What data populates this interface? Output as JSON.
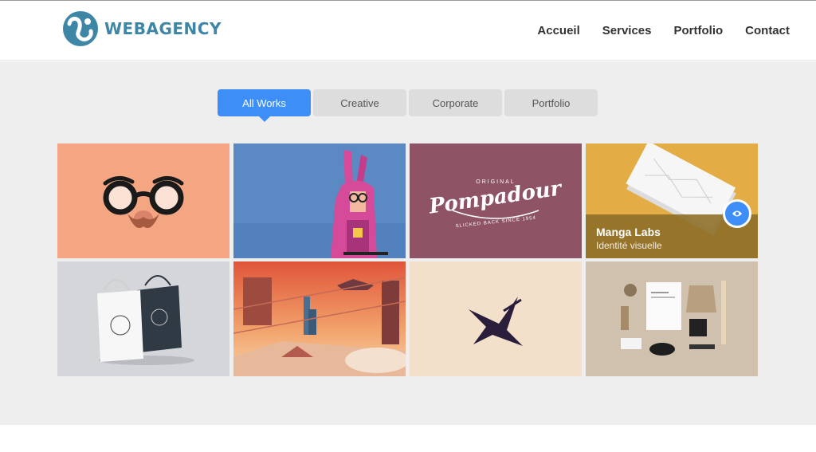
{
  "brand": {
    "name": "WEBAGENCY",
    "logo_icon": "swirl-logo-icon",
    "color": "#3d86a6"
  },
  "nav": {
    "items": [
      {
        "label": "Accueil"
      },
      {
        "label": "Services"
      },
      {
        "label": "Portfolio"
      },
      {
        "label": "Contact"
      }
    ]
  },
  "filters": {
    "items": [
      {
        "label": "All Works",
        "active": true
      },
      {
        "label": "Creative",
        "active": false
      },
      {
        "label": "Corporate",
        "active": false
      },
      {
        "label": "Portfolio",
        "active": false
      }
    ],
    "active_color": "#3e8ef7"
  },
  "portfolio": {
    "items": [
      {
        "image": "glasses-mustache-illustration"
      },
      {
        "image": "pink-bunny-costume-illustration"
      },
      {
        "image": "pompadour-logo-design",
        "logo_text": "Pompadour",
        "logo_top": "ORIGINAL",
        "logo_bottom": "SLICKED BACK SINCE 1954"
      },
      {
        "image": "business-card-mockup",
        "title": "Manga Labs",
        "subtitle": "Identité visuelle",
        "action_icon": "eye-icon"
      },
      {
        "image": "shopping-bags-mockup"
      },
      {
        "image": "sunset-city-illustration"
      },
      {
        "image": "abstract-bird-logo"
      },
      {
        "image": "stationery-branding-mockup"
      }
    ]
  }
}
